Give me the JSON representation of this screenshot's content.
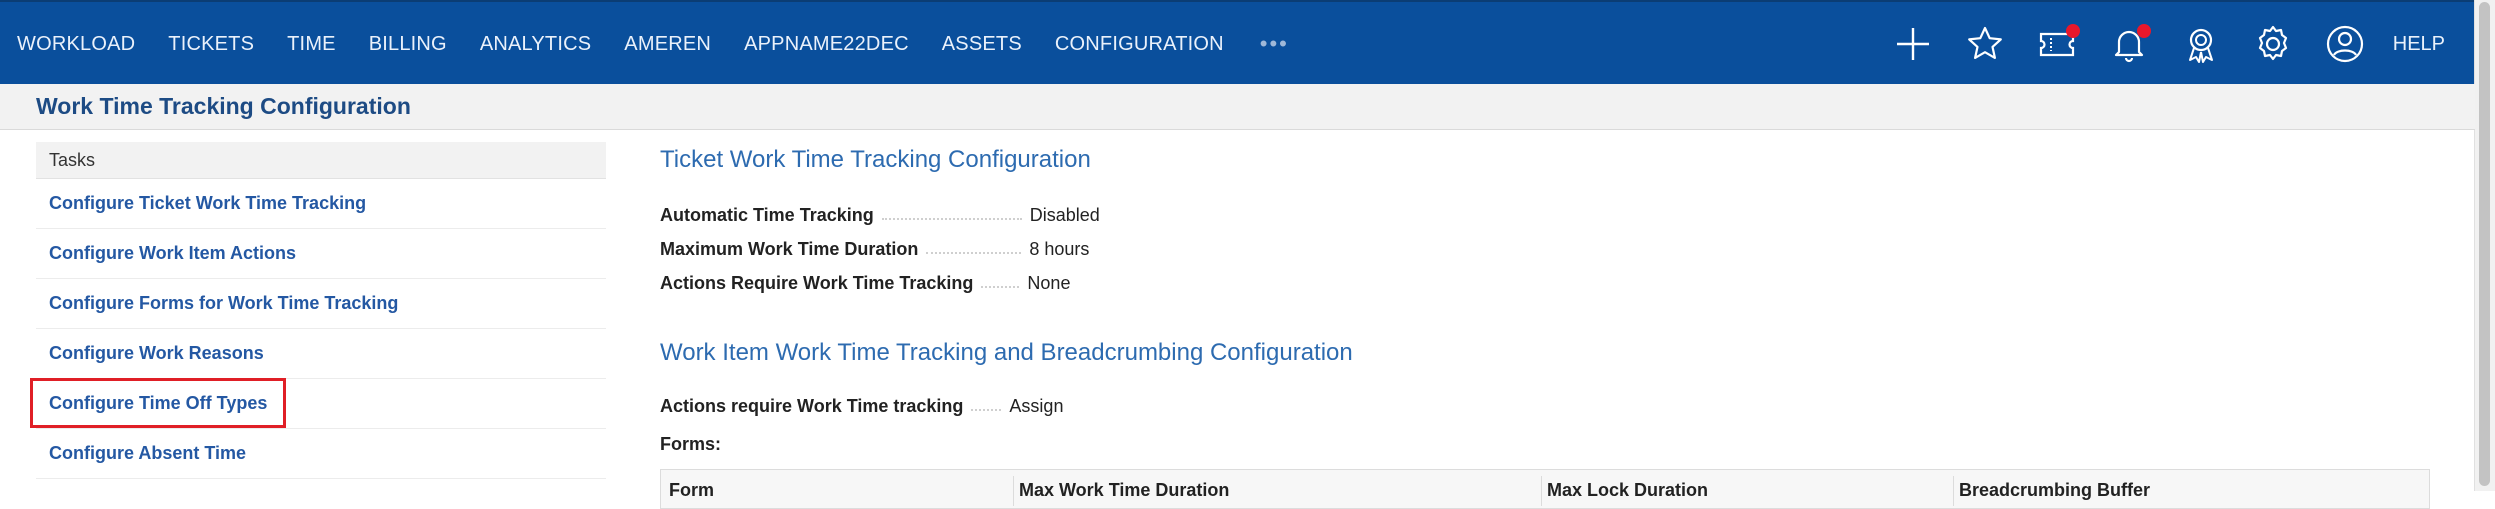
{
  "nav": {
    "items": [
      "WORKLOAD",
      "TICKETS",
      "TIME",
      "BILLING",
      "ANALYTICS",
      "AMEREN",
      "APPNAME22DEC",
      "ASSETS",
      "CONFIGURATION"
    ],
    "more": "•••",
    "help": "HELP",
    "icons": [
      "plus-icon",
      "star-icon",
      "ticket-icon",
      "bell-icon",
      "award-icon",
      "gear-icon",
      "user-icon"
    ],
    "colors": {
      "bar": "#0a4f9c",
      "badge": "#e8172b"
    }
  },
  "page": {
    "title": "Work Time Tracking Configuration"
  },
  "tasks": {
    "header": "Tasks",
    "items": [
      "Configure Ticket Work Time Tracking",
      "Configure Work Item Actions",
      "Configure Forms for Work Time Tracking",
      "Configure Work Reasons",
      "Configure Time Off Types",
      "Configure Absent Time"
    ]
  },
  "ticket_config": {
    "title": "Ticket Work Time Tracking Configuration",
    "rows": [
      {
        "label": "Automatic Time Tracking",
        "value": "Disabled"
      },
      {
        "label": "Maximum Work Time Duration",
        "value": "8 hours"
      },
      {
        "label": "Actions Require Work Time Tracking",
        "value": "None"
      }
    ]
  },
  "workitem_config": {
    "title": "Work Item Work Time Tracking and Breadcrumbing Configuration",
    "rows": [
      {
        "label": "Actions require Work Time tracking",
        "value": "Assign"
      }
    ],
    "forms_label": "Forms:",
    "columns": [
      "Form",
      "Max Work Time Duration",
      "Max Lock Duration",
      "Breadcrumbing Buffer"
    ]
  }
}
